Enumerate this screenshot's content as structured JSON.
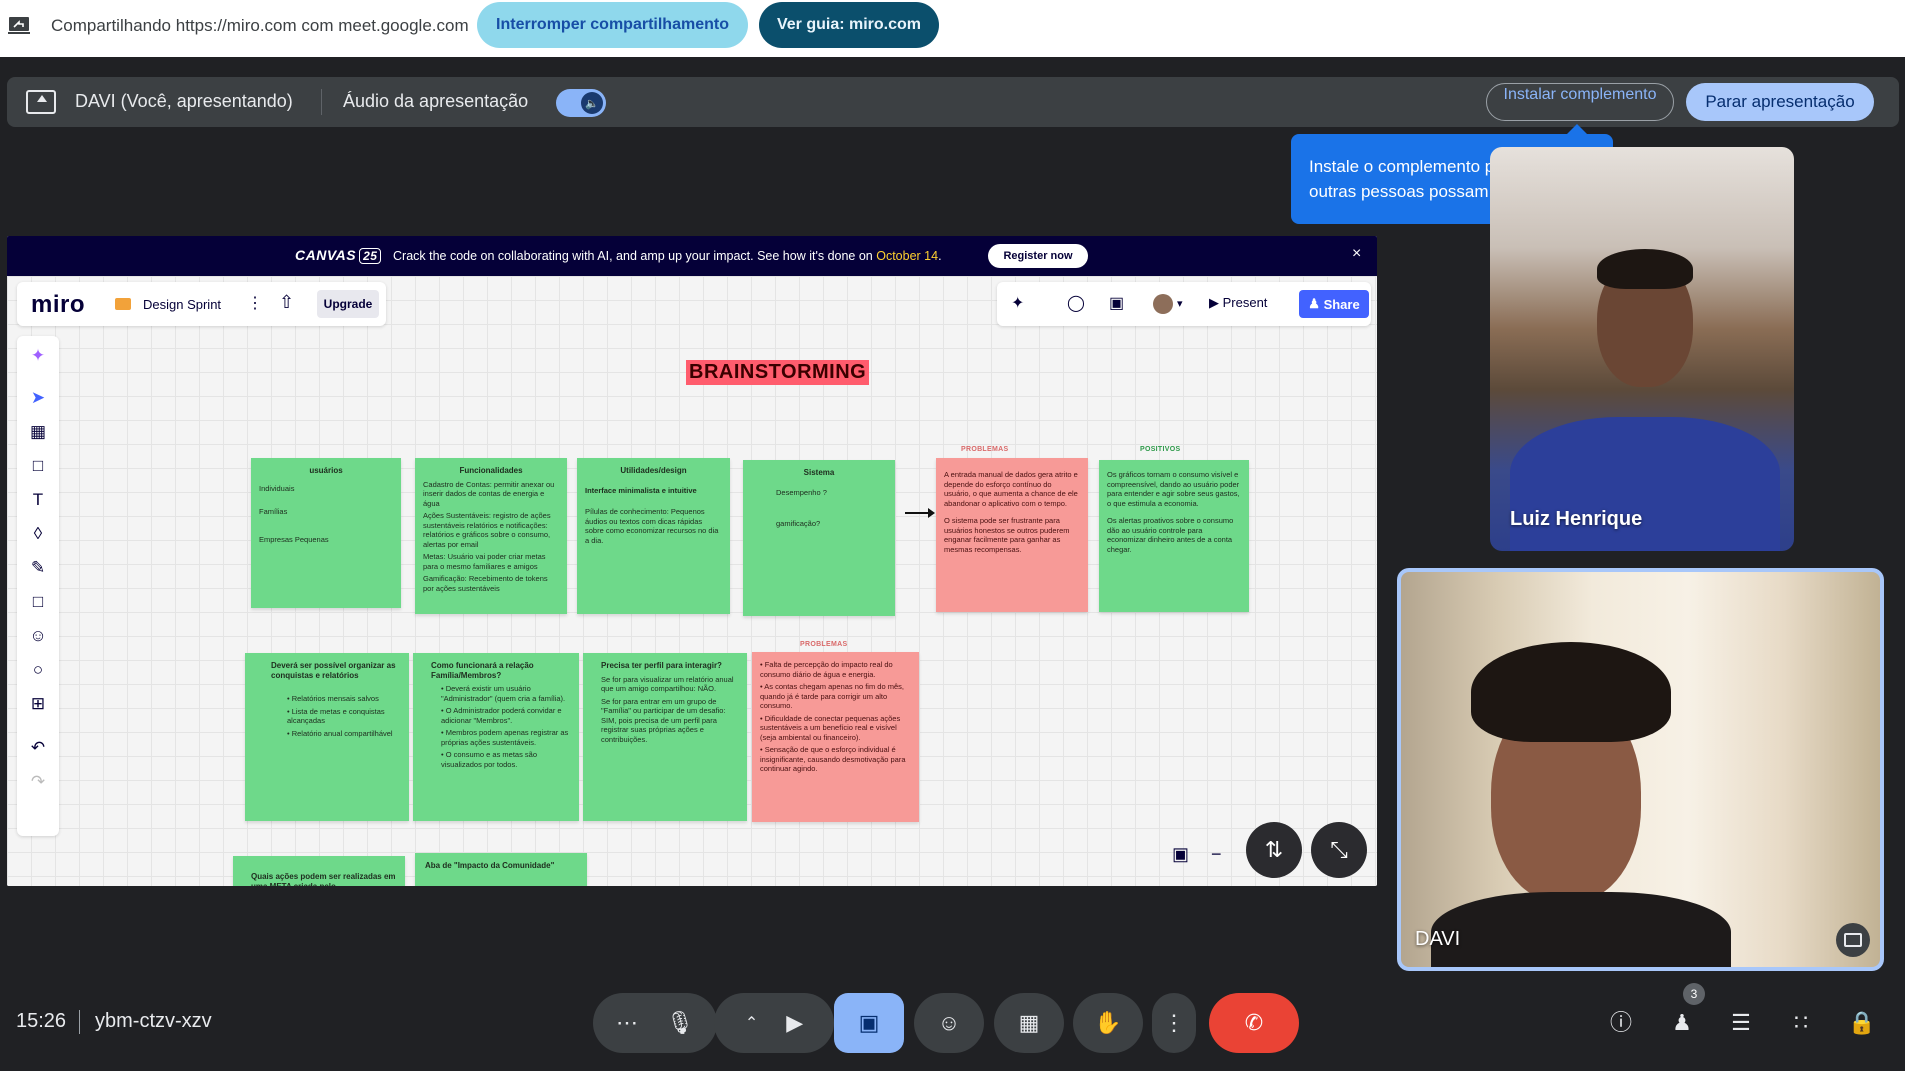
{
  "sharebar": {
    "text": "Compartilhando https://miro.com com meet.google.com",
    "stop_label": "Interromper compartilhamento",
    "guide_label": "Ver guia: miro.com"
  },
  "presbar": {
    "presenter": "DAVI (Você, apresentando)",
    "audio_label": "Áudio da apresentação",
    "audio_on": true,
    "install_label": "Instalar complemento",
    "stop_label": "Parar apresentação"
  },
  "tooltip": {
    "text": "Instale o complemento para que outras pessoas possam colaborar"
  },
  "participants": [
    {
      "name": "Luiz Henrique"
    },
    {
      "name": "DAVI"
    }
  ],
  "miro": {
    "banner": {
      "logo": "CANVAS",
      "logo_year": "25",
      "message": "Crack the code on collaborating with AI, and amp up your impact. See how it's done on ",
      "date": "October 14",
      "message_end": ".",
      "register_label": "Register now",
      "close": "×"
    },
    "app": {
      "logo": "miro",
      "board_name": "Design Sprint",
      "upgrade_label": "Upgrade",
      "present_label": "Present",
      "share_label": "Share"
    },
    "board_title": "BRAINSTORMING",
    "categories": {
      "problems1": "PROBLEMAS",
      "positives": "POSITIVOS",
      "problems2": "PROBLEMAS"
    },
    "notes": [
      {
        "title": "usuários",
        "lines": [
          "Individuais",
          "Famílias",
          "Empresas Pequenas"
        ]
      },
      {
        "title": "Funcionalidades",
        "lines": [
          "Cadastro de Contas: permitir anexar ou inserir dados de contas de energia e água",
          "Ações Sustentáveis: registro de ações sustentáveis relatórios e notificações: relatórios e gráficos sobre o consumo, alertas por email",
          "Metas: Usuário vai poder criar metas para o mesmo familiares e amigos",
          "Gamificação: Recebimento de tokens por ações sustentáveis"
        ]
      },
      {
        "title": "Utilidades/design",
        "lines": [
          "Interface minimalista e intuitive",
          "Pílulas de conhecimento: Pequenos áudios ou textos com dicas rápidas sobre como economizar recursos no dia a dia."
        ]
      },
      {
        "title": "Sistema",
        "lines": [
          "Desempenho ?",
          "gamificação?"
        ]
      },
      {
        "title": "",
        "lines": [
          "A entrada manual de dados gera atrito e depende do esforço contínuo do usuário, o que aumenta a chance de ele abandonar o aplicativo com o tempo.",
          "O sistema pode ser frustrante para usuários honestos se outros puderem enganar facilmente para ganhar as mesmas recompensas."
        ]
      },
      {
        "title": "",
        "lines": [
          "Os gráficos tornam o consumo visível e compreensível, dando ao usuário poder para entender e agir sobre seus gastos, o que estimula a economia.",
          "Os alertas proativos sobre o consumo dão ao usuário controle para economizar dinheiro antes de a conta chegar."
        ]
      },
      {
        "title": "Deverá ser possível organizar as conquistas e relatórios",
        "lines": [
          "• Relatórios mensais salvos",
          "• Lista de metas e conquistas alcançadas",
          "• Relatório anual compartilhável"
        ]
      },
      {
        "title": "Como funcionará a relação Família/Membros?",
        "lines": [
          "• Deverá existir um usuário \"Administrador\" (quem cria a família).",
          "• O Administrador poderá convidar e adicionar \"Membros\".",
          "• Membros podem apenas registrar as próprias ações sustentáveis.",
          "• O consumo e as metas são visualizados por todos."
        ]
      },
      {
        "title": "Precisa ter perfil para interagir?",
        "lines": [
          "Se for para visualizar um relatório anual que um amigo compartilhou: NÃO.",
          "Se for para entrar em um grupo de \"Família\" ou participar de um desafio: SIM, pois precisa de um perfil para registrar suas próprias ações e contribuições."
        ]
      },
      {
        "title": "",
        "lines": [
          "• Falta de percepção do impacto real do consumo diário de água e energia.",
          "• As contas chegam apenas no fim do mês, quando já é tarde para corrigir um alto consumo.",
          "• Dificuldade de conectar pequenas ações sustentáveis a um benefício real e visível (seja ambiental ou financeiro).",
          "• Sensação de que o esforço individual é insignificante, causando desmotivação para continuar agindo."
        ]
      },
      {
        "title": "Quais ações podem ser realizadas em uma META criada pelo",
        "lines": []
      },
      {
        "title": "Aba de \"Impacto da Comunidade\"",
        "lines": []
      }
    ]
  },
  "bottom": {
    "time": "15:26",
    "meeting_code": "ybm-ctzv-xzv",
    "participant_count": "3"
  },
  "colors": {
    "note_green": "#6ed98a",
    "note_red": "#f79a97",
    "end_call": "#ea4335",
    "accent_blue": "#8ab4f8",
    "miro_blue": "#4262ff"
  }
}
